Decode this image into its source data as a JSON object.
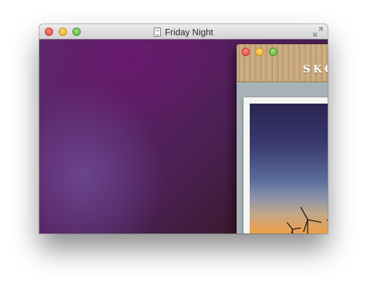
{
  "window": {
    "title": "Friday Night",
    "doc_icon": "document-icon",
    "fullscreen_icon": "fullscreen-arrows-icon"
  },
  "inner_window": {
    "heading": "SKO",
    "image_icon": "wind-turbines-photo"
  },
  "colors": {
    "close": "#e0443e",
    "minimize": "#e9a92a",
    "zoom": "#54b43a",
    "wallpaper": "#5b1f63"
  }
}
